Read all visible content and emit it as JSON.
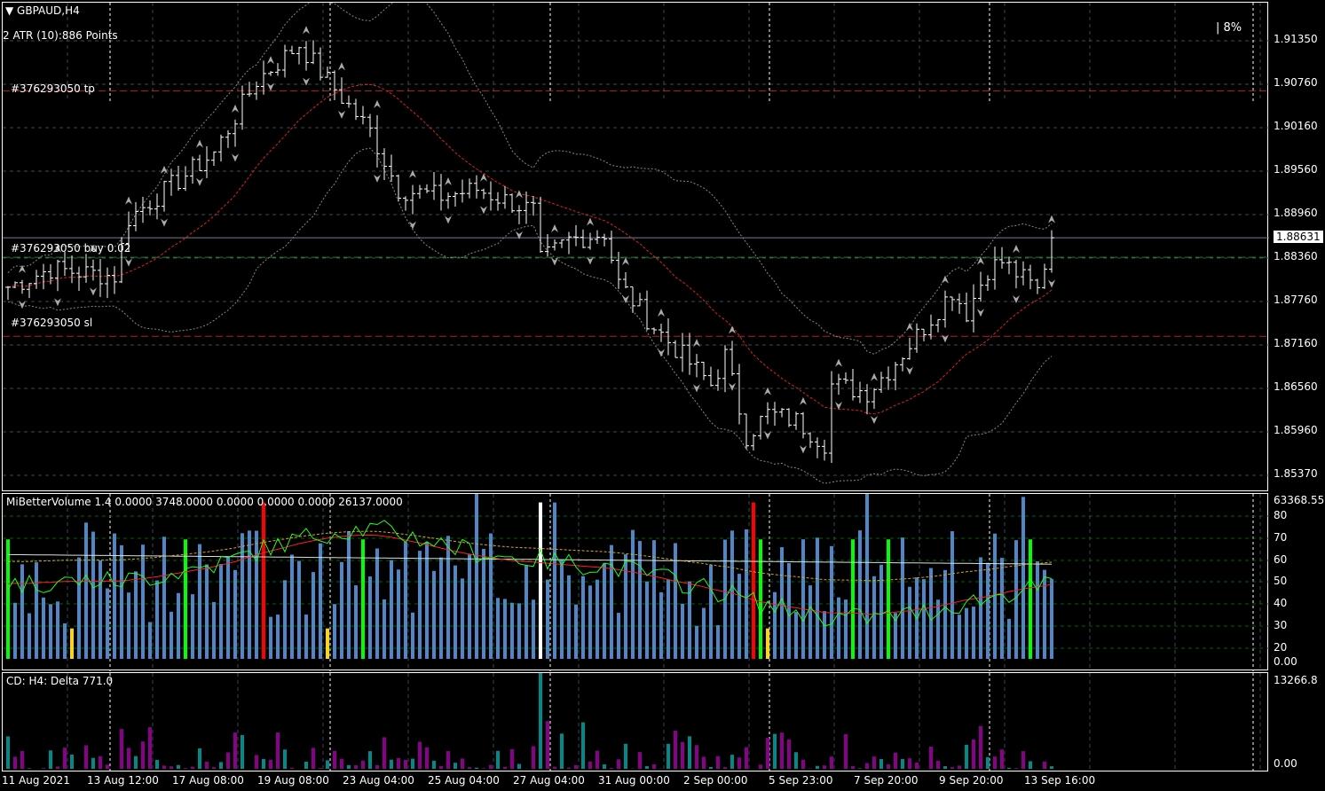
{
  "symbol": "GBPAUD,H4",
  "atr_label": "2 ATR (10):886 Points",
  "percent": "| 8%",
  "orders": {
    "tp": "#376293050 tp",
    "buy": "#376293050 buy 0.02",
    "sl": "#376293050 sl"
  },
  "price_axis": [
    "1.91350",
    "1.90760",
    "1.90160",
    "1.89560",
    "1.88960",
    "1.88360",
    "1.87760",
    "1.87160",
    "1.86560",
    "1.85960",
    "1.85370"
  ],
  "current_price": "1.88631",
  "volume": {
    "label": "MiBetterVolume 1.4 0.0000 3748.0000 0.0000 0.0000 0.0000 26137.0000",
    "axis": [
      "63368.55",
      "80",
      "70",
      "60",
      "50",
      "40",
      "30",
      "20",
      "0.00"
    ]
  },
  "delta": {
    "label": "CD: H4: Delta  771.0",
    "axis": [
      "13266.8",
      "0.00"
    ]
  },
  "time_axis": [
    "11 Aug 2021",
    "13 Aug 12:00",
    "17 Aug 08:00",
    "19 Aug 08:00",
    "23 Aug 04:00",
    "25 Aug 04:00",
    "27 Aug 04:00",
    "31 Aug 00:00",
    "2 Sep 00:00",
    "5 Sep 23:00",
    "7 Sep 20:00",
    "9 Sep 20:00",
    "13 Sep 16:00"
  ],
  "chart_data": {
    "type": "ohlc",
    "waypoints": [
      [
        0,
        1.8795
      ],
      [
        6,
        1.882
      ],
      [
        15,
        1.881
      ],
      [
        17,
        1.889
      ],
      [
        21,
        1.892
      ],
      [
        29,
        1.898
      ],
      [
        35,
        1.908
      ],
      [
        41,
        1.913
      ],
      [
        45,
        1.908
      ],
      [
        51,
        1.901
      ],
      [
        55,
        1.893
      ],
      [
        61,
        1.892
      ],
      [
        66,
        1.893
      ],
      [
        74,
        1.89
      ],
      [
        75,
        1.883
      ],
      [
        79,
        1.886
      ],
      [
        84,
        1.887
      ],
      [
        86,
        1.88
      ],
      [
        91,
        1.874
      ],
      [
        95,
        1.87
      ],
      [
        99,
        1.866
      ],
      [
        101,
        1.87
      ],
      [
        104,
        1.859
      ],
      [
        107,
        1.862
      ],
      [
        111,
        1.861
      ],
      [
        115,
        1.858
      ],
      [
        116,
        1.866
      ],
      [
        121,
        1.865
      ],
      [
        124,
        1.868
      ],
      [
        129,
        1.874
      ],
      [
        133,
        1.879
      ],
      [
        135,
        1.876
      ],
      [
        138,
        1.882
      ],
      [
        140,
        1.883
      ],
      [
        145,
        1.879
      ],
      [
        147,
        1.8863
      ]
    ],
    "colors": {
      "volume": "#4f86c6",
      "climax": "#ff0000",
      "churn": "#00ff00",
      "low": "#ffd700",
      "delta_pos": "#008b8b",
      "delta_neg": "#8b008b"
    }
  }
}
